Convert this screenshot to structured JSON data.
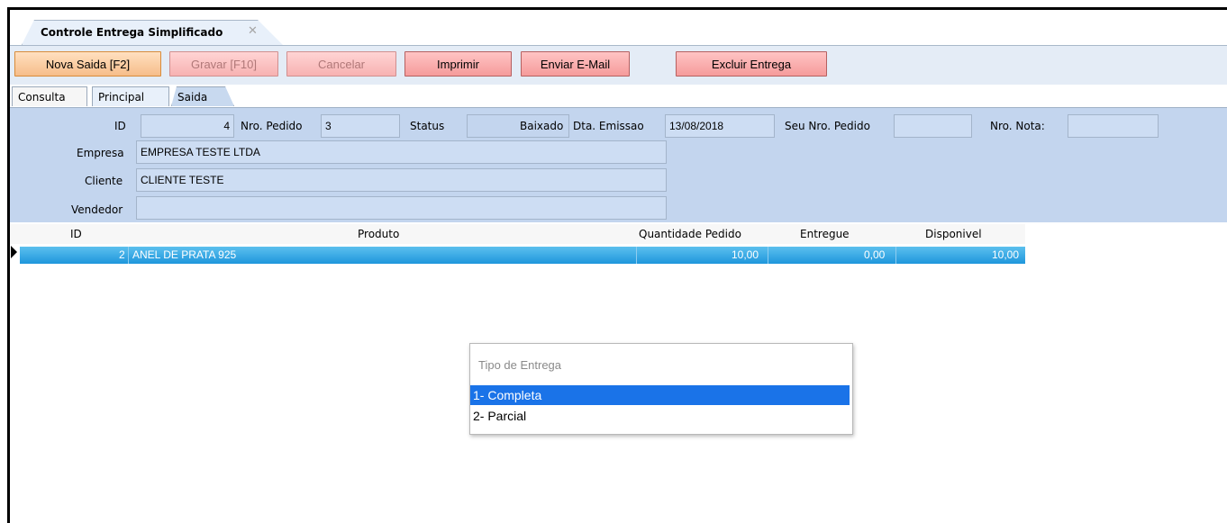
{
  "window": {
    "tab_title": "Controle Entrega Simplificado",
    "close_glyph": "✕"
  },
  "toolbar": {
    "nova_saida": "Nova Saida [F2]",
    "gravar": "Gravar [F10]",
    "cancelar": "Cancelar",
    "imprimir": "Imprimir",
    "enviar_email": "Enviar E-Mail",
    "excluir_entrega": "Excluir Entrega"
  },
  "tabs": [
    {
      "label": "Consulta"
    },
    {
      "label": "Principal"
    },
    {
      "label": "Saida"
    }
  ],
  "form": {
    "id_label": "ID",
    "id_value": "4",
    "nro_pedido_label": "Nro. Pedido",
    "nro_pedido_value": "3",
    "status_label": "Status",
    "status_value": "Baixado",
    "dta_emissao_label": "Dta. Emissao",
    "dta_emissao_value": "13/08/2018",
    "seu_nro_pedido_label": "Seu Nro. Pedido",
    "seu_nro_pedido_value": "",
    "nro_nota_label": "Nro. Nota:",
    "nro_nota_value": "",
    "empresa_label": "Empresa",
    "empresa_value": "EMPRESA TESTE LTDA",
    "cliente_label": "Cliente",
    "cliente_value": "CLIENTE TESTE",
    "vendedor_label": "Vendedor",
    "vendedor_value": ""
  },
  "grid": {
    "columns": [
      "ID",
      "Produto",
      "Quantidade Pedido",
      "Entregue",
      "Disponivel"
    ],
    "rows": [
      {
        "id": "2",
        "produto": "ANEL DE PRATA 925",
        "quantidade": "10,00",
        "entregue": "0,00",
        "disponivel": "10,00"
      }
    ]
  },
  "popup": {
    "title": "Tipo de Entrega",
    "options": [
      "1- Completa",
      "2- Parcial"
    ],
    "selected_index": 0
  },
  "colors": {
    "button_red": "#f59b9b",
    "selection_blue": "#1e96dc",
    "panel_blue": "#c3d5ee"
  }
}
